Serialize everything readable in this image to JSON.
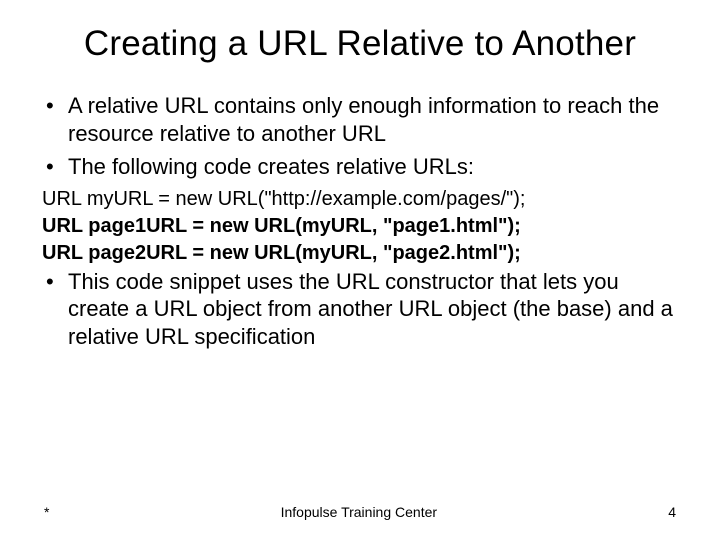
{
  "title": "Creating a URL Relative to Another",
  "bullets": {
    "b1": "A relative URL contains only enough information to reach the resource relative to another URL",
    "b2": "The following code creates relative URLs:",
    "b3": "This code snippet uses the URL constructor that lets you create a URL object from another URL object (the base) and a relative URL specification"
  },
  "code": {
    "line1": "URL myURL = new URL(\"http://example.com/pages/\");",
    "line2": "URL page1URL = new URL(myURL, \"page1.html\");",
    "line3": "URL page2URL = new URL(myURL, \"page2.html\");"
  },
  "footer": {
    "left": "*",
    "center": "Infopulse Training Center",
    "right": "4"
  }
}
